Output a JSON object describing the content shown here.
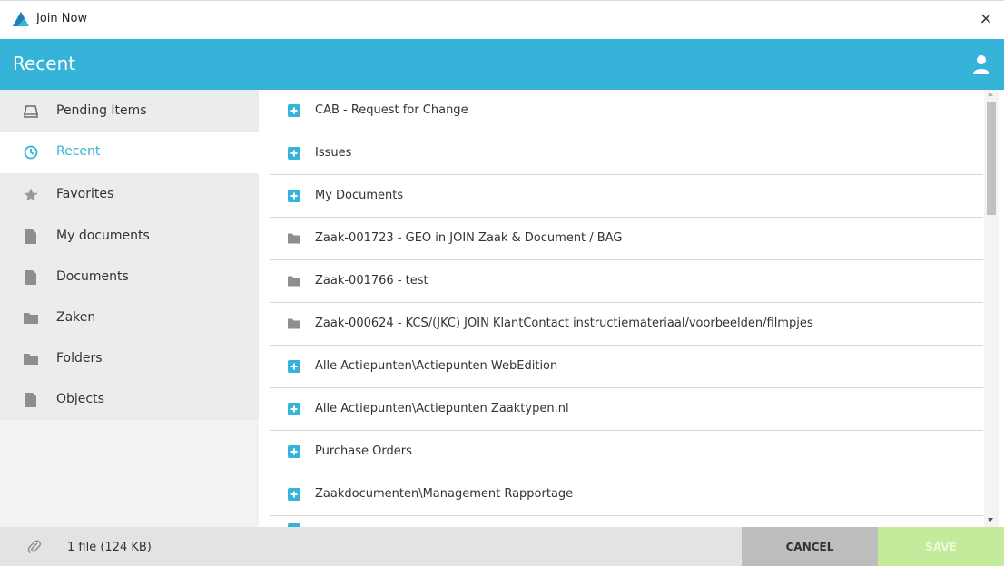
{
  "window": {
    "title": "Join Now",
    "close_label": "×"
  },
  "header": {
    "title": "Recent",
    "user_icon": "user-icon"
  },
  "sidebar": {
    "items": [
      {
        "label": "Pending Items",
        "icon": "inbox-icon"
      },
      {
        "label": "Recent",
        "icon": "clock-icon",
        "active": true
      },
      {
        "label": "Favorites",
        "icon": "star-icon"
      },
      {
        "label": "My documents",
        "icon": "document-icon"
      },
      {
        "label": "Documents",
        "icon": "document-icon"
      },
      {
        "label": "Zaken",
        "icon": "folder-icon"
      },
      {
        "label": "Folders",
        "icon": "folder-icon"
      },
      {
        "label": "Objects",
        "icon": "document-icon"
      }
    ]
  },
  "list": {
    "items": [
      {
        "label": "CAB - Request for Change",
        "icon": "add-document-icon"
      },
      {
        "label": "Issues",
        "icon": "add-document-icon"
      },
      {
        "label": "My Documents",
        "icon": "add-document-icon"
      },
      {
        "label": "Zaak-001723 - GEO in JOIN Zaak & Document / BAG",
        "icon": "folder-icon"
      },
      {
        "label": "Zaak-001766 - test",
        "icon": "folder-icon"
      },
      {
        "label": "Zaak-000624 - KCS/(JKC) JOIN KlantContact instructiemateriaal/voorbeelden/filmpjes",
        "icon": "folder-icon"
      },
      {
        "label": "Alle Actiepunten\\Actiepunten WebEdition",
        "icon": "add-document-icon"
      },
      {
        "label": "Alle Actiepunten\\Actiepunten Zaaktypen.nl",
        "icon": "add-document-icon"
      },
      {
        "label": "Purchase Orders",
        "icon": "add-document-icon"
      },
      {
        "label": "Zaakdocumenten\\Management Rapportage",
        "icon": "add-document-icon"
      }
    ]
  },
  "footer": {
    "file_info": "1 file (124 KB)",
    "cancel_label": "CANCEL",
    "save_label": "SAVE"
  },
  "colors": {
    "accent": "#36b3d9",
    "save": "#c4eb9b",
    "cancel": "#bdbdbd"
  }
}
